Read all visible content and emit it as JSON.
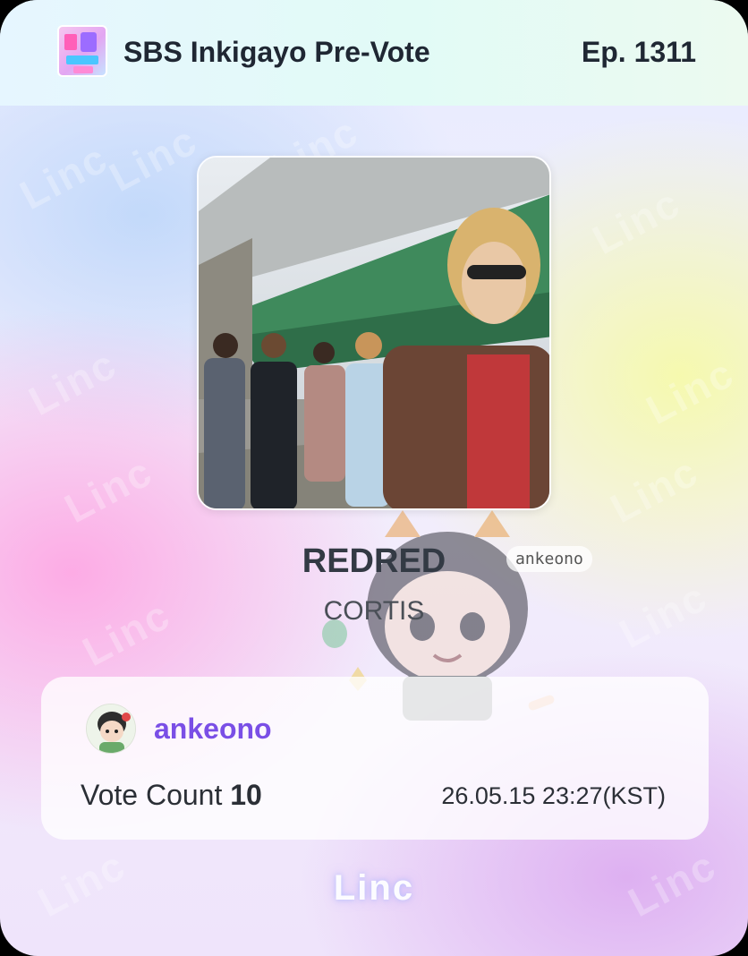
{
  "header": {
    "show_title": "SBS Inkigayo Pre-Vote",
    "episode": "Ep. 1311"
  },
  "song": {
    "title": "REDRED",
    "artist": "CORTIS"
  },
  "sticker": {
    "tag_text": "ankeono"
  },
  "vote": {
    "username": "ankeono",
    "count_label": "Vote Count",
    "count_value": "10",
    "timestamp": "26.05.15 23:27(KST)"
  },
  "footer": {
    "brand": "Linc"
  },
  "watermark_text": "Linc",
  "colors": {
    "username": "#7a4fe6",
    "text_dark": "#1f2733",
    "header_bg": "#e3f8fa"
  }
}
